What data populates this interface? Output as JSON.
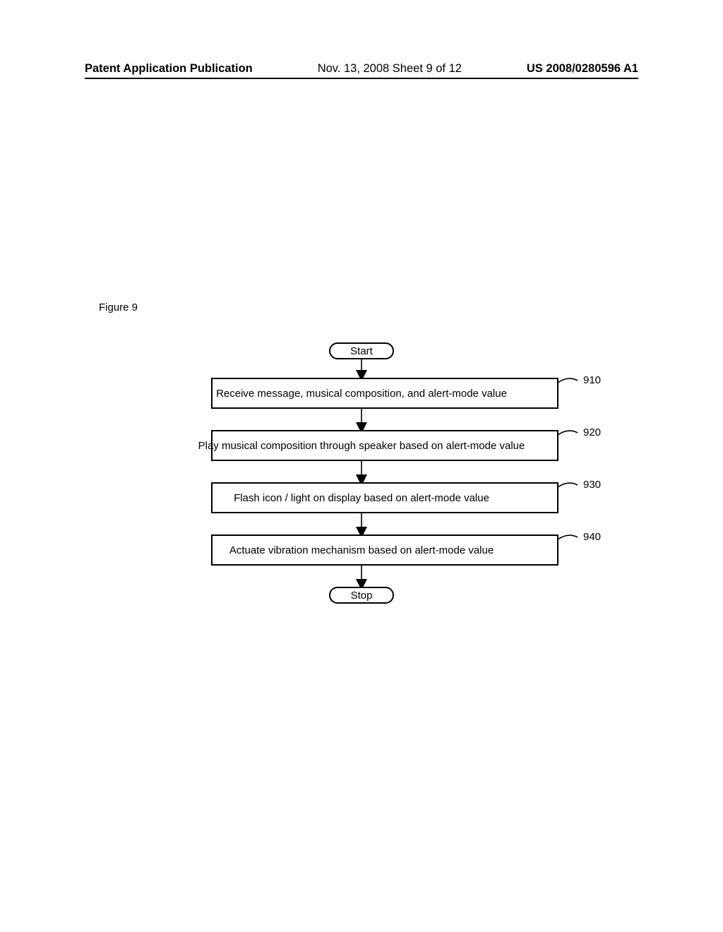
{
  "header": {
    "left": "Patent Application Publication",
    "center": "Nov. 13, 2008  Sheet 9 of 12",
    "right": "US 2008/0280596 A1"
  },
  "figure_caption": "Figure 9",
  "flow": {
    "start": "Start",
    "stop": "Stop",
    "steps": [
      {
        "text": "Receive message, musical composition, and alert-mode value",
        "ref": "910"
      },
      {
        "text": "Play musical composition through speaker based on alert-mode value",
        "ref": "920"
      },
      {
        "text": "Flash icon / light on display based on alert-mode value",
        "ref": "930"
      },
      {
        "text": "Actuate vibration mechanism based on alert-mode value",
        "ref": "940"
      }
    ]
  }
}
